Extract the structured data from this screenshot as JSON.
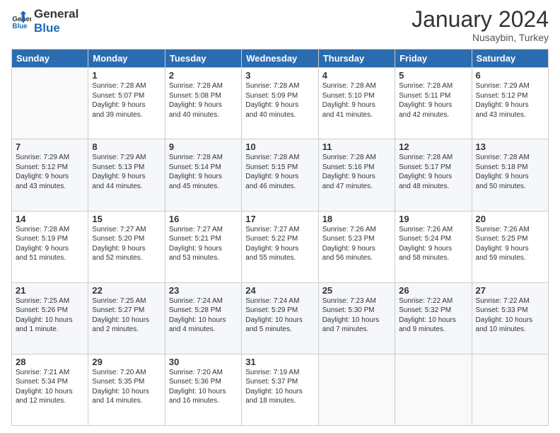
{
  "header": {
    "logo_line1": "General",
    "logo_line2": "Blue",
    "month_year": "January 2024",
    "location": "Nusaybin, Turkey"
  },
  "weekdays": [
    "Sunday",
    "Monday",
    "Tuesday",
    "Wednesday",
    "Thursday",
    "Friday",
    "Saturday"
  ],
  "weeks": [
    [
      {
        "day": "",
        "info": ""
      },
      {
        "day": "1",
        "info": "Sunrise: 7:28 AM\nSunset: 5:07 PM\nDaylight: 9 hours\nand 39 minutes."
      },
      {
        "day": "2",
        "info": "Sunrise: 7:28 AM\nSunset: 5:08 PM\nDaylight: 9 hours\nand 40 minutes."
      },
      {
        "day": "3",
        "info": "Sunrise: 7:28 AM\nSunset: 5:09 PM\nDaylight: 9 hours\nand 40 minutes."
      },
      {
        "day": "4",
        "info": "Sunrise: 7:28 AM\nSunset: 5:10 PM\nDaylight: 9 hours\nand 41 minutes."
      },
      {
        "day": "5",
        "info": "Sunrise: 7:28 AM\nSunset: 5:11 PM\nDaylight: 9 hours\nand 42 minutes."
      },
      {
        "day": "6",
        "info": "Sunrise: 7:29 AM\nSunset: 5:12 PM\nDaylight: 9 hours\nand 43 minutes."
      }
    ],
    [
      {
        "day": "7",
        "info": "Sunrise: 7:29 AM\nSunset: 5:12 PM\nDaylight: 9 hours\nand 43 minutes."
      },
      {
        "day": "8",
        "info": "Sunrise: 7:29 AM\nSunset: 5:13 PM\nDaylight: 9 hours\nand 44 minutes."
      },
      {
        "day": "9",
        "info": "Sunrise: 7:28 AM\nSunset: 5:14 PM\nDaylight: 9 hours\nand 45 minutes."
      },
      {
        "day": "10",
        "info": "Sunrise: 7:28 AM\nSunset: 5:15 PM\nDaylight: 9 hours\nand 46 minutes."
      },
      {
        "day": "11",
        "info": "Sunrise: 7:28 AM\nSunset: 5:16 PM\nDaylight: 9 hours\nand 47 minutes."
      },
      {
        "day": "12",
        "info": "Sunrise: 7:28 AM\nSunset: 5:17 PM\nDaylight: 9 hours\nand 48 minutes."
      },
      {
        "day": "13",
        "info": "Sunrise: 7:28 AM\nSunset: 5:18 PM\nDaylight: 9 hours\nand 50 minutes."
      }
    ],
    [
      {
        "day": "14",
        "info": "Sunrise: 7:28 AM\nSunset: 5:19 PM\nDaylight: 9 hours\nand 51 minutes."
      },
      {
        "day": "15",
        "info": "Sunrise: 7:27 AM\nSunset: 5:20 PM\nDaylight: 9 hours\nand 52 minutes."
      },
      {
        "day": "16",
        "info": "Sunrise: 7:27 AM\nSunset: 5:21 PM\nDaylight: 9 hours\nand 53 minutes."
      },
      {
        "day": "17",
        "info": "Sunrise: 7:27 AM\nSunset: 5:22 PM\nDaylight: 9 hours\nand 55 minutes."
      },
      {
        "day": "18",
        "info": "Sunrise: 7:26 AM\nSunset: 5:23 PM\nDaylight: 9 hours\nand 56 minutes."
      },
      {
        "day": "19",
        "info": "Sunrise: 7:26 AM\nSunset: 5:24 PM\nDaylight: 9 hours\nand 58 minutes."
      },
      {
        "day": "20",
        "info": "Sunrise: 7:26 AM\nSunset: 5:25 PM\nDaylight: 9 hours\nand 59 minutes."
      }
    ],
    [
      {
        "day": "21",
        "info": "Sunrise: 7:25 AM\nSunset: 5:26 PM\nDaylight: 10 hours\nand 1 minute."
      },
      {
        "day": "22",
        "info": "Sunrise: 7:25 AM\nSunset: 5:27 PM\nDaylight: 10 hours\nand 2 minutes."
      },
      {
        "day": "23",
        "info": "Sunrise: 7:24 AM\nSunset: 5:28 PM\nDaylight: 10 hours\nand 4 minutes."
      },
      {
        "day": "24",
        "info": "Sunrise: 7:24 AM\nSunset: 5:29 PM\nDaylight: 10 hours\nand 5 minutes."
      },
      {
        "day": "25",
        "info": "Sunrise: 7:23 AM\nSunset: 5:30 PM\nDaylight: 10 hours\nand 7 minutes."
      },
      {
        "day": "26",
        "info": "Sunrise: 7:22 AM\nSunset: 5:32 PM\nDaylight: 10 hours\nand 9 minutes."
      },
      {
        "day": "27",
        "info": "Sunrise: 7:22 AM\nSunset: 5:33 PM\nDaylight: 10 hours\nand 10 minutes."
      }
    ],
    [
      {
        "day": "28",
        "info": "Sunrise: 7:21 AM\nSunset: 5:34 PM\nDaylight: 10 hours\nand 12 minutes."
      },
      {
        "day": "29",
        "info": "Sunrise: 7:20 AM\nSunset: 5:35 PM\nDaylight: 10 hours\nand 14 minutes."
      },
      {
        "day": "30",
        "info": "Sunrise: 7:20 AM\nSunset: 5:36 PM\nDaylight: 10 hours\nand 16 minutes."
      },
      {
        "day": "31",
        "info": "Sunrise: 7:19 AM\nSunset: 5:37 PM\nDaylight: 10 hours\nand 18 minutes."
      },
      {
        "day": "",
        "info": ""
      },
      {
        "day": "",
        "info": ""
      },
      {
        "day": "",
        "info": ""
      }
    ]
  ]
}
